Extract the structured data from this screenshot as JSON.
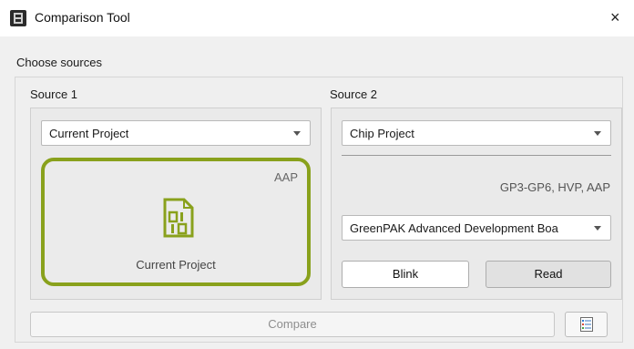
{
  "window": {
    "title": "Comparison Tool",
    "close_glyph": "×"
  },
  "group": {
    "label": "Choose sources"
  },
  "source1": {
    "label": "Source 1",
    "selected": "Current Project",
    "card": {
      "tag": "AAP",
      "caption": "Current Project",
      "icon": "binary-file-icon"
    }
  },
  "source2": {
    "label": "Source 2",
    "selected": "Chip Project",
    "chip_info": "GP3-GP6, HVP, AAP",
    "board": "GreenPAK Advanced Development Boa",
    "blink_label": "Blink",
    "read_label": "Read"
  },
  "footer": {
    "compare_label": "Compare",
    "report_icon": "report-list-icon"
  },
  "colors": {
    "accent": "#89a11c",
    "disabled_text": "#8e8e8e"
  }
}
